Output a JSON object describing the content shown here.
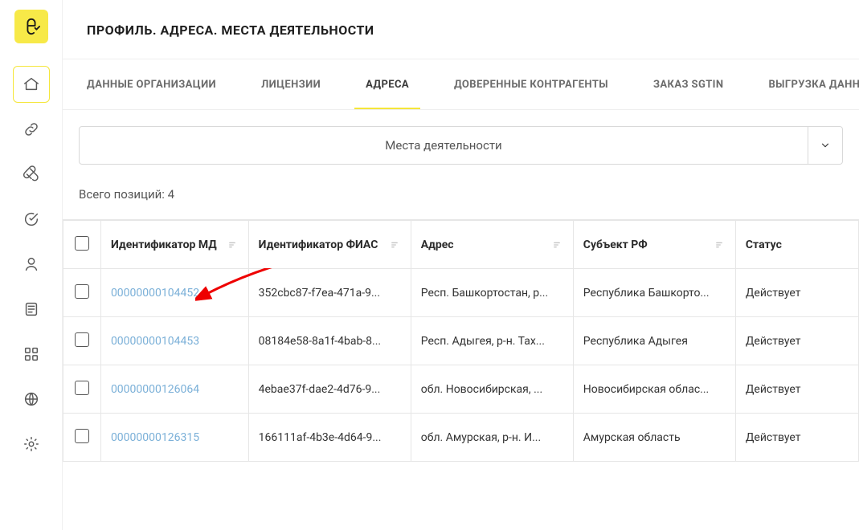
{
  "page_title": "ПРОФИЛЬ. АДРЕСА. МЕСТА ДЕЯТЕЛЬНОСТИ",
  "tabs": [
    {
      "label": "ДАННЫЕ ОРГАНИЗАЦИИ"
    },
    {
      "label": "ЛИЦЕНЗИИ"
    },
    {
      "label": "АДРЕСА"
    },
    {
      "label": "ДОВЕРЕННЫЕ КОНТРАГЕНТЫ"
    },
    {
      "label": "ЗАКАЗ SGTIN"
    },
    {
      "label": "ВЫГРУЗКА ДАННЫХ"
    }
  ],
  "active_tab_index": 2,
  "dropdown": {
    "label": "Места деятельности"
  },
  "summary": {
    "prefix": "Всего позиций: ",
    "count": "4"
  },
  "columns": {
    "md": "Идентификатор МД",
    "fias": "Идентификатор ФИАС",
    "addr": "Адрес",
    "subj": "Субъект РФ",
    "status": "Статус"
  },
  "rows": [
    {
      "md": "00000000104452",
      "fias": "352cbc87-f7ea-471a-9...",
      "addr": "Респ. Башкортостан, р...",
      "subj": "Республика Башкорто...",
      "status": "Действует"
    },
    {
      "md": "00000000104453",
      "fias": "08184e58-8a1f-4bab-8...",
      "addr": "Респ. Адыгея, р-н. Тах...",
      "subj": "Республика Адыгея",
      "status": "Действует"
    },
    {
      "md": "00000000126064",
      "fias": "4ebae37f-dae2-4d76-9...",
      "addr": "обл. Новосибирская, ...",
      "subj": "Новосибирская облас...",
      "status": "Действует"
    },
    {
      "md": "00000000126315",
      "fias": "166111af-4b3e-4d64-9...",
      "addr": "обл. Амурская, р-н. И...",
      "subj": "Амурская область",
      "status": "Действует"
    }
  ]
}
